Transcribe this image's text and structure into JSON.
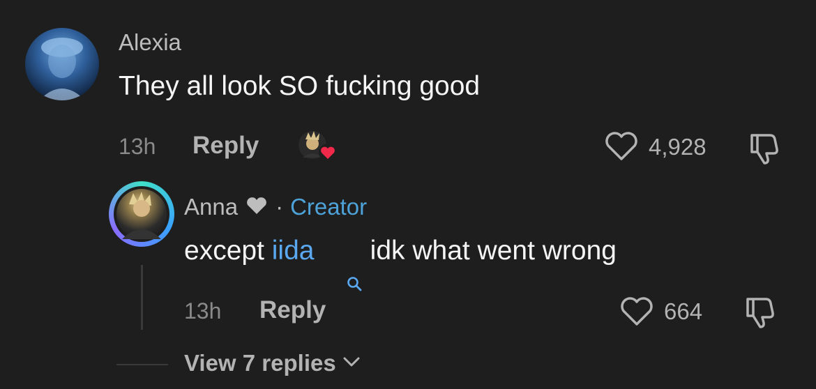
{
  "comment": {
    "username": "Alexia",
    "text": "They all look SO fucking good",
    "time": "13h",
    "reply_label": "Reply",
    "like_count": "4,928"
  },
  "reply": {
    "username": "Anna",
    "separator": "·",
    "badge": "Creator",
    "text_before": "except ",
    "mention": "iida",
    "text_after": " idk what went wrong",
    "time": "13h",
    "reply_label": "Reply",
    "like_count": "664"
  },
  "view_replies": "View 7 replies",
  "colors": {
    "background": "#1e1e1e",
    "creator_badge": "#4da3d9",
    "link": "#5aa8f0",
    "heart_badge": "#f0294b"
  }
}
